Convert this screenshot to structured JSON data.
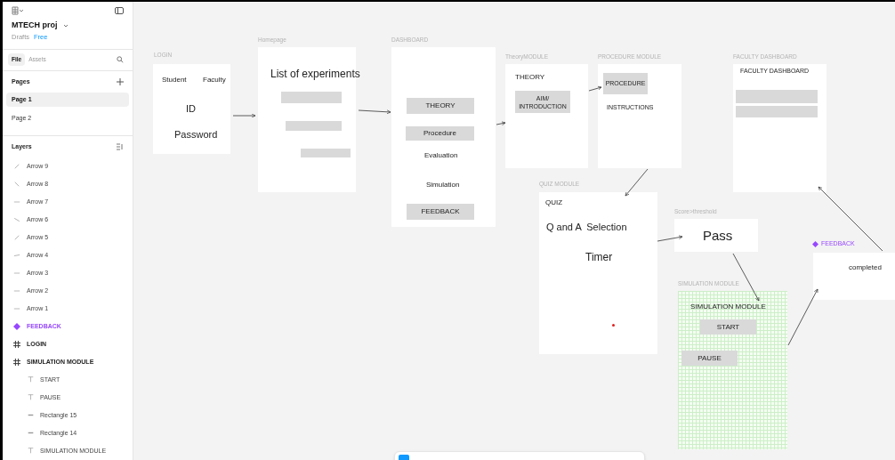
{
  "sidebar": {
    "project": "MTECH proj",
    "team": "Drafts",
    "plan": "Free",
    "tabs": [
      {
        "label": "File",
        "selected": true
      },
      {
        "label": "Assets",
        "selected": false
      }
    ],
    "pages_title": "Pages",
    "pages": [
      {
        "label": "Page 1",
        "selected": true
      },
      {
        "label": "Page 2",
        "selected": false
      }
    ],
    "layers_title": "Layers",
    "layers": [
      {
        "kind": "arrow",
        "name": "Arrow 9"
      },
      {
        "kind": "arrow",
        "name": "Arrow 8"
      },
      {
        "kind": "arrow",
        "name": "Arrow 7"
      },
      {
        "kind": "arrow",
        "name": "Arrow 6"
      },
      {
        "kind": "arrow",
        "name": "Arrow 5"
      },
      {
        "kind": "arrow",
        "name": "Arrow 4"
      },
      {
        "kind": "arrow",
        "name": "Arrow 3"
      },
      {
        "kind": "arrow",
        "name": "Arrow 2"
      },
      {
        "kind": "arrow",
        "name": "Arrow 1"
      },
      {
        "kind": "component",
        "name": "FEEDBACK"
      },
      {
        "kind": "frame",
        "name": "LOGIN"
      },
      {
        "kind": "frame",
        "name": "SIMULATION MODULE",
        "children": [
          {
            "kind": "text",
            "name": "START"
          },
          {
            "kind": "text",
            "name": "PAUSE"
          },
          {
            "kind": "rectangle",
            "name": "Rectangle 15"
          },
          {
            "kind": "rectangle",
            "name": "Rectangle 14"
          },
          {
            "kind": "text",
            "name": "SIMULATION MODULE"
          }
        ]
      }
    ]
  },
  "canvas": {
    "frames": [
      {
        "kind": "frame",
        "label": "LOGIN",
        "items": [
          {
            "kind": "text",
            "text": "Student"
          },
          {
            "kind": "text",
            "text": "Faculty"
          },
          {
            "kind": "text",
            "text": "ID"
          },
          {
            "kind": "text",
            "text": "Password"
          }
        ]
      },
      {
        "kind": "frame",
        "label": "Homepage",
        "items": [
          {
            "kind": "text",
            "text": "List of experiments"
          },
          {
            "kind": "bar"
          },
          {
            "kind": "bar"
          },
          {
            "kind": "bar"
          }
        ]
      },
      {
        "kind": "frame",
        "label": "DASHBOARD",
        "items": [
          {
            "kind": "bar",
            "text": "THEORY"
          },
          {
            "kind": "bar",
            "text": "Procedure"
          },
          {
            "kind": "text",
            "text": "Evaluation"
          },
          {
            "kind": "text",
            "text": "Simulation"
          },
          {
            "kind": "bar",
            "text": "FEEDBACK"
          }
        ]
      },
      {
        "kind": "frame",
        "label": "TheoryMODULE",
        "items": [
          {
            "kind": "text",
            "text": "THEORY"
          },
          {
            "kind": "bar",
            "text": "AIM/ INTRODUCTION"
          }
        ]
      },
      {
        "kind": "frame",
        "label": "PROCEDURE MODULE",
        "items": [
          {
            "kind": "bar",
            "text": "PROCEDURE"
          },
          {
            "kind": "text",
            "text": "INSTRUCTIONS"
          }
        ]
      },
      {
        "kind": "frame",
        "label": "FACULTY DASHBOARD",
        "items": [
          {
            "kind": "text",
            "text": "FACULTY DASHBOARD"
          },
          {
            "kind": "bar"
          },
          {
            "kind": "bar"
          }
        ]
      },
      {
        "kind": "frame",
        "label": "QUIZ MODULE",
        "items": [
          {
            "kind": "text",
            "text": "QUIZ"
          },
          {
            "kind": "text",
            "text": "Q and A  Selection"
          },
          {
            "kind": "text",
            "text": "Timer"
          },
          {
            "kind": "dot"
          }
        ]
      },
      {
        "kind": "frame",
        "label": "Score>threshold",
        "items": [
          {
            "kind": "text",
            "text": "Pass"
          }
        ]
      },
      {
        "kind": "grid",
        "label": "SIMULATION MODULE",
        "items": [
          {
            "kind": "text",
            "text": "SIMULATION MODULE"
          },
          {
            "kind": "bar",
            "text": "START"
          },
          {
            "kind": "bar",
            "text": "PAUSE"
          }
        ]
      },
      {
        "kind": "component",
        "label": "FEEDBACK",
        "items": [
          {
            "kind": "text",
            "text": "completed"
          }
        ]
      }
    ]
  }
}
